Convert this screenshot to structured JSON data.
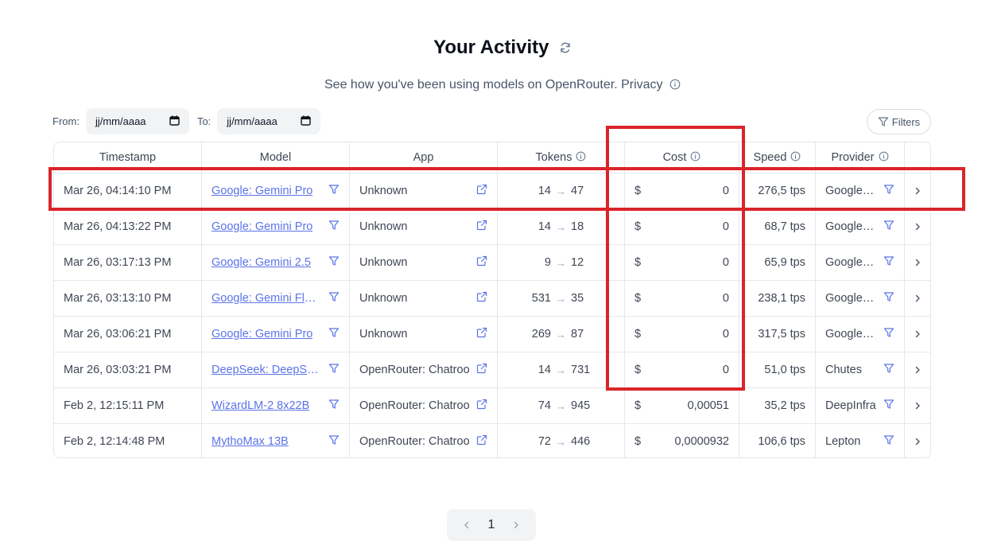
{
  "header": {
    "title": "Your Activity",
    "subtitle": "See how you've been using models on OpenRouter. Privacy"
  },
  "filters": {
    "from_label": "From:",
    "from_value": "jj/mm/aaaa",
    "to_label": "To:",
    "to_value": "jj/mm/aaaa",
    "filters_button": "Filters"
  },
  "table": {
    "columns": {
      "timestamp": "Timestamp",
      "model": "Model",
      "app": "App",
      "tokens": "Tokens",
      "cost": "Cost",
      "speed": "Speed",
      "provider": "Provider"
    },
    "rows": [
      {
        "timestamp": "Mar 26, 04:14:10 PM",
        "model": "Google: Gemini Pro",
        "app": "Unknown",
        "tokens_in": "14",
        "tokens_out": "47",
        "currency": "$",
        "cost": "0",
        "speed": "276,5 tps",
        "provider": "Google AI Studio"
      },
      {
        "timestamp": "Mar 26, 04:13:22 PM",
        "model": "Google: Gemini Pro",
        "app": "Unknown",
        "tokens_in": "14",
        "tokens_out": "18",
        "currency": "$",
        "cost": "0",
        "speed": "68,7 tps",
        "provider": "Google AI Studio"
      },
      {
        "timestamp": "Mar 26, 03:17:13 PM",
        "model": "Google: Gemini 2.5",
        "app": "Unknown",
        "tokens_in": "9",
        "tokens_out": "12",
        "currency": "$",
        "cost": "0",
        "speed": "65,9 tps",
        "provider": "Google AI Studio"
      },
      {
        "timestamp": "Mar 26, 03:13:10 PM",
        "model": "Google: Gemini Flash",
        "app": "Unknown",
        "tokens_in": "531",
        "tokens_out": "35",
        "currency": "$",
        "cost": "0",
        "speed": "238,1 tps",
        "provider": "Google AI Studio"
      },
      {
        "timestamp": "Mar 26, 03:06:21 PM",
        "model": "Google: Gemini Pro",
        "app": "Unknown",
        "tokens_in": "269",
        "tokens_out": "87",
        "currency": "$",
        "cost": "0",
        "speed": "317,5 tps",
        "provider": "Google AI Studio"
      },
      {
        "timestamp": "Mar 26, 03:03:21 PM",
        "model": "DeepSeek: DeepSeek",
        "app": "OpenRouter: Chatroom",
        "tokens_in": "14",
        "tokens_out": "731",
        "currency": "$",
        "cost": "0",
        "speed": "51,0 tps",
        "provider": "Chutes"
      },
      {
        "timestamp": "Feb 2, 12:15:11 PM",
        "model": "WizardLM-2 8x22B",
        "app": "OpenRouter: Chatroom",
        "tokens_in": "74",
        "tokens_out": "945",
        "currency": "$",
        "cost": "0,00051",
        "speed": "35,2 tps",
        "provider": "DeepInfra"
      },
      {
        "timestamp": "Feb 2, 12:14:48 PM",
        "model": "MythoMax 13B",
        "app": "OpenRouter: Chatroom",
        "tokens_in": "72",
        "tokens_out": "446",
        "currency": "$",
        "cost": "0,0000932",
        "speed": "106,6 tps",
        "provider": "Lepton"
      }
    ]
  },
  "pagination": {
    "current_page": "1"
  },
  "colors": {
    "link": "#5b73e8",
    "highlight": "#d9252a"
  }
}
